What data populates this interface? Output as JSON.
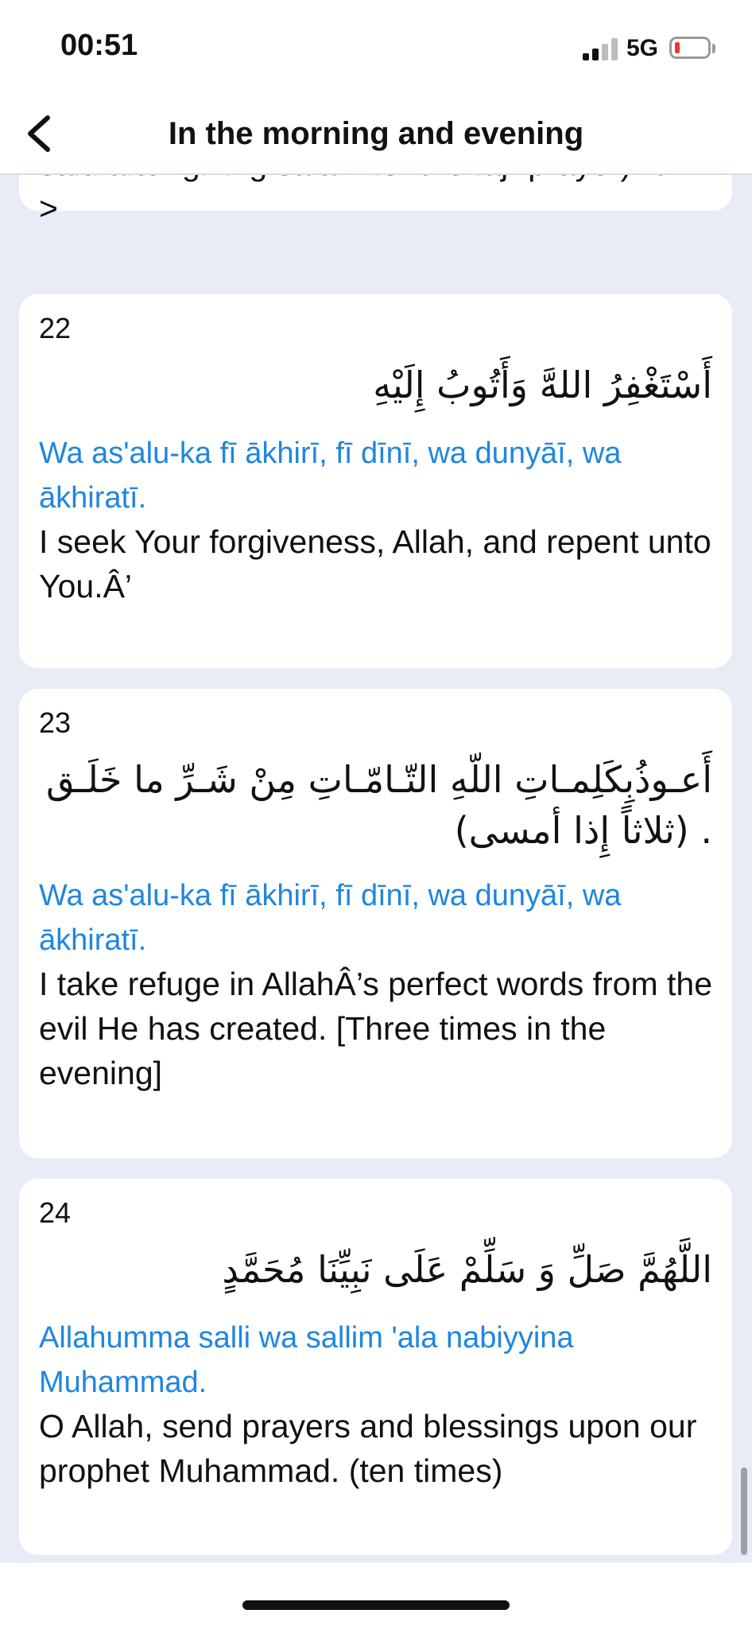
{
  "status_bar": {
    "time": "00:51",
    "network": "5G"
  },
  "nav": {
    "title": "In the morning and evening"
  },
  "cards": [
    {
      "tail_text": "said after giving salam for the fajr prayer)<br ?>"
    },
    {
      "number": "22",
      "arabic": "أَسْتَغْفِرُ اللهَّ وَأَتُوبُ إِلَيْهِ",
      "transliteration": "Wa as'alu-ka fī ākhirī, fī dīnī, wa dunyāī, wa ākhiratī.",
      "translation": "I seek Your forgiveness, Allah, and repent unto You.Â’"
    },
    {
      "number": "23",
      "arabic": "أَعـوذُبِكَلِمـاتِ اللّهِ التّـامّـاتِ مِنْ شَـرِّ ما خَلَـق . (ثلاثاً إِذا أمسى)",
      "transliteration": "Wa as'alu-ka fī ākhirī, fī dīnī, wa dunyāī, wa ākhiratī.",
      "translation": "I take refuge in AllahÂ’s perfect words from the evil He has created. [Three times in the evening]"
    },
    {
      "number": "24",
      "arabic": "اللَّهُمَّ صَلِّ وَ سَلِّمْ عَلَى نَبِيِّنَا مُحَمَّدٍ",
      "transliteration": "Allahumma salli wa sallim 'ala nabiyyina Muhammad.",
      "translation": "O Allah, send prayers and blessings upon our prophet Muhammad. (ten times)"
    }
  ],
  "icons": {
    "back": "chevron-left-icon",
    "signal": "cellular-signal-icon",
    "battery": "battery-low-icon"
  },
  "colors": {
    "accent": "#1f86e0",
    "background": "#e8edf5",
    "card": "#ffffff",
    "battery_low": "#e53935"
  }
}
